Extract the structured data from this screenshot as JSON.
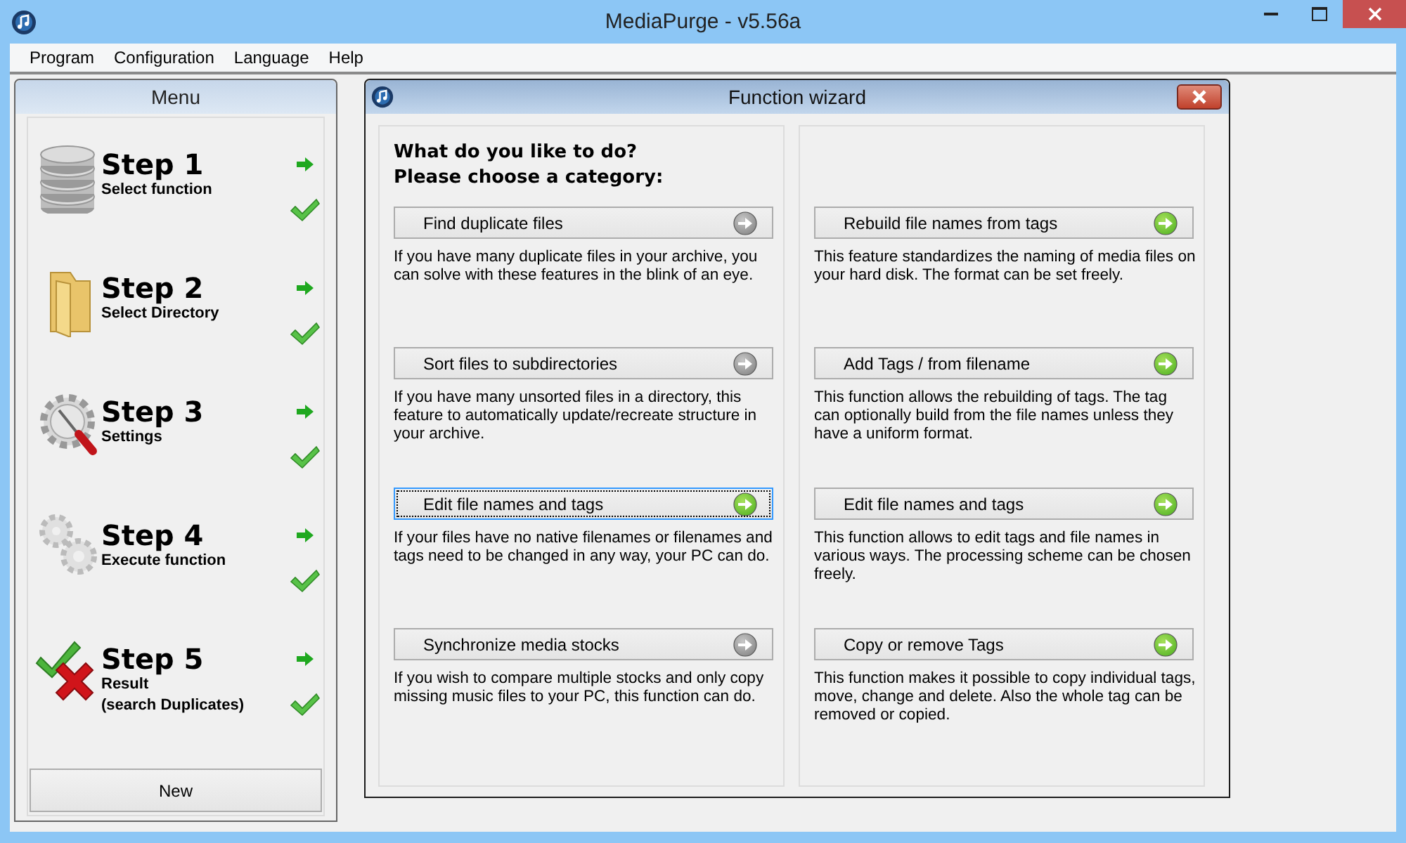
{
  "window": {
    "title": "MediaPurge - v5.56a"
  },
  "menubar": [
    "Program",
    "Configuration",
    "Language",
    "Help"
  ],
  "sidebar": {
    "title": "Menu",
    "steps": [
      {
        "title": "Step 1",
        "subtitle": "Select function",
        "kind": "database"
      },
      {
        "title": "Step 2",
        "subtitle": "Select Directory",
        "kind": "folder"
      },
      {
        "title": "Step 3",
        "subtitle": "Settings",
        "kind": "settings"
      },
      {
        "title": "Step 4",
        "subtitle": "Execute function",
        "kind": "gears"
      },
      {
        "title": "Step 5",
        "subtitle": "Result\n(search Duplicates)",
        "kind": "result"
      }
    ],
    "new_button": "New"
  },
  "wizard": {
    "title": "Function wizard",
    "heading": [
      "What do you like to do?",
      "Please choose a category:"
    ],
    "columns": [
      [
        {
          "label": "Find duplicate files",
          "available": false,
          "focused": false,
          "description": "If you have many duplicate files in your archive, you can solve with these features in the blink of an eye."
        },
        {
          "label": "Sort files to subdirectories",
          "available": false,
          "focused": false,
          "description": "If you have many unsorted files in a directory, this feature to automatically update/recreate structure in your archive."
        },
        {
          "label": "Edit file names and tags",
          "available": true,
          "focused": true,
          "description": "If your files have no native filenames or filenames and tags need to be changed in any way, your PC can do."
        },
        {
          "label": "Synchronize media stocks",
          "available": false,
          "focused": false,
          "description": "If you wish to compare multiple stocks and only copy missing music files to your PC, this function can do."
        }
      ],
      [
        {
          "label": "Rebuild file names from tags",
          "available": true,
          "focused": false,
          "description": "This feature standardizes the naming of media files on your hard disk. The format can be set freely."
        },
        {
          "label": "Add Tags / from filename",
          "available": true,
          "focused": false,
          "description": "This function allows the rebuilding of tags. The tag can optionally build from the file names unless they have a uniform format."
        },
        {
          "label": "Edit file names and tags",
          "available": true,
          "focused": false,
          "description": "This function allows to edit tags and file names in various ways. The processing scheme can be chosen freely."
        },
        {
          "label": "Copy or remove Tags",
          "available": true,
          "focused": false,
          "description": "This function makes it possible to copy individual tags, move, change and delete. Also the whole tag can be removed or copied."
        }
      ]
    ]
  }
}
